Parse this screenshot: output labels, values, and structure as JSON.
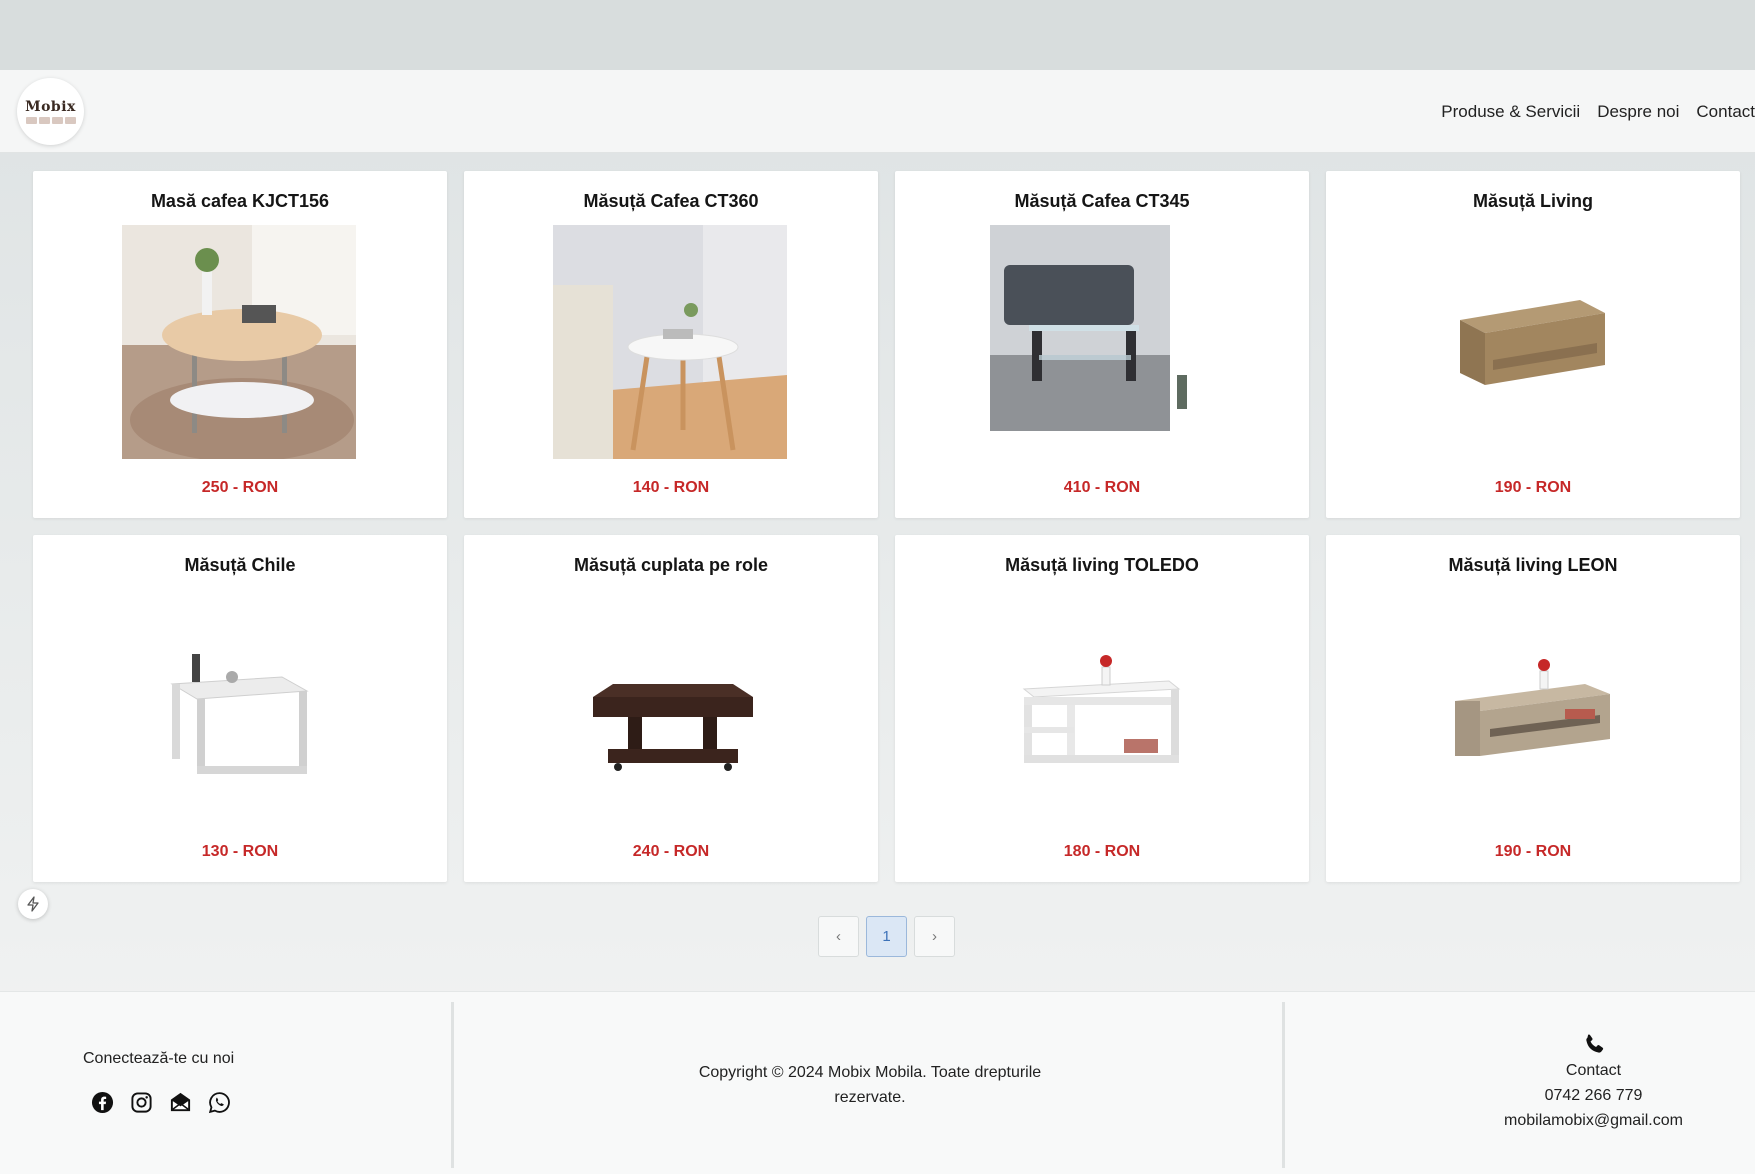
{
  "header": {
    "logo_text": "Mobix",
    "nav": [
      "Produse & Servicii",
      "Despre noi",
      "Contact"
    ]
  },
  "products": [
    {
      "title": "Masă cafea KJCT156",
      "price": "250 - RON"
    },
    {
      "title": "Măsuță Cafea CT360",
      "price": "140 - RON"
    },
    {
      "title": "Măsuță Cafea CT345",
      "price": "410 - RON"
    },
    {
      "title": "Măsuță Living",
      "price": "190 - RON"
    },
    {
      "title": "Măsuță Chile",
      "price": "130 - RON"
    },
    {
      "title": "Măsuță cuplata pe role",
      "price": "240 - RON"
    },
    {
      "title": "Măsuță living TOLEDO",
      "price": "180 - RON"
    },
    {
      "title": "Măsuță living LEON",
      "price": "190 - RON"
    }
  ],
  "pagination": {
    "prev": "‹",
    "current": "1",
    "next": "›"
  },
  "footer": {
    "connect_title": "Conectează-te cu noi",
    "copyright": "Copyright © 2024 Mobix Mobila. Toate drepturile rezervate.",
    "contact_label": "Contact",
    "phone": "0742 266 779",
    "email": "mobilamobix@gmail.com"
  },
  "colors": {
    "price": "#c62828",
    "pagination_active": "#dbe7f5"
  }
}
